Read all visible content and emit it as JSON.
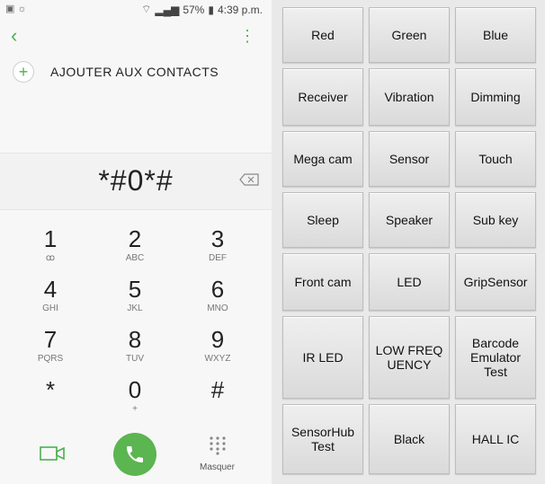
{
  "status": {
    "battery": "57%",
    "time": "4:39 p.m."
  },
  "dialer": {
    "add_contacts": "AJOUTER AUX CONTACTS",
    "number": "*#0*#",
    "keys": [
      {
        "digit": "1",
        "letters": "ꝏ"
      },
      {
        "digit": "2",
        "letters": "ABC"
      },
      {
        "digit": "3",
        "letters": "DEF"
      },
      {
        "digit": "4",
        "letters": "GHI"
      },
      {
        "digit": "5",
        "letters": "JKL"
      },
      {
        "digit": "6",
        "letters": "MNO"
      },
      {
        "digit": "7",
        "letters": "PQRS"
      },
      {
        "digit": "8",
        "letters": "TUV"
      },
      {
        "digit": "9",
        "letters": "WXYZ"
      },
      {
        "digit": "*",
        "letters": ""
      },
      {
        "digit": "0",
        "letters": "+"
      },
      {
        "digit": "#",
        "letters": ""
      }
    ],
    "hide_label": "Masquer"
  },
  "test_menu": {
    "buttons": [
      "Red",
      "Green",
      "Blue",
      "Receiver",
      "Vibration",
      "Dimming",
      "Mega cam",
      "Sensor",
      "Touch",
      "Sleep",
      "Speaker",
      "Sub key",
      "Front cam",
      "LED",
      "GripSensor",
      "IR LED",
      "LOW FREQUENCY",
      "Barcode Emulator Test",
      "SensorHub Test",
      "Black",
      "HALL IC"
    ]
  },
  "colors": {
    "accent": "#4caf50",
    "call": "#5bb550"
  }
}
